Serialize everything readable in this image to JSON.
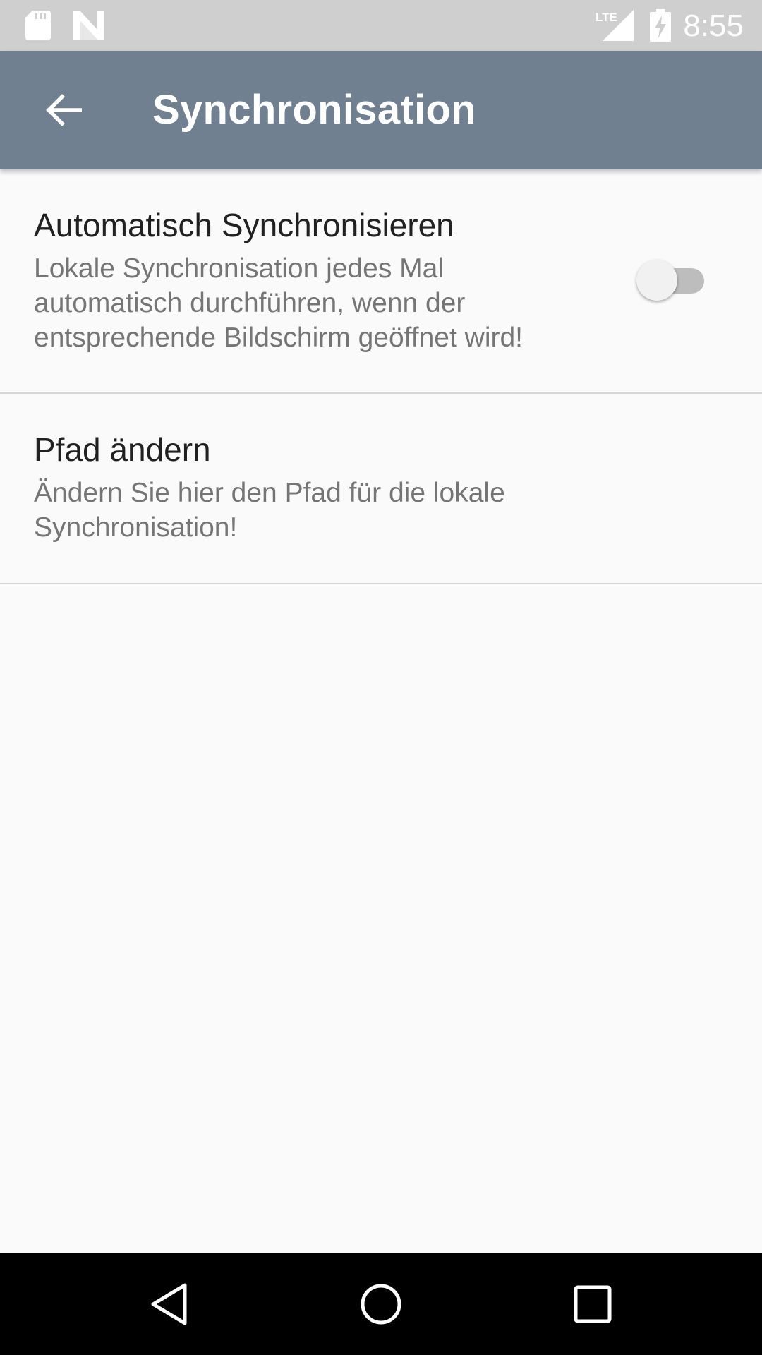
{
  "status_bar": {
    "time": "8:55",
    "network_type": "LTE",
    "icons": [
      "sd-card-icon",
      "n-logo-icon",
      "signal-icon",
      "battery-charging-icon"
    ]
  },
  "app_bar": {
    "title": "Synchronisation",
    "back_icon": "arrow-back-icon",
    "background_color": "#708090"
  },
  "preferences": [
    {
      "title": "Automatisch Synchronisieren",
      "summary": "Lokale Synchronisation jedes Mal automatisch durchführen, wenn der entsprechende Bildschirm geöffnet wird!",
      "switch_on": false
    },
    {
      "title": "Pfad ändern",
      "summary": "Ändern Sie hier den Pfad für die lokale Synchronisation!"
    }
  ],
  "nav_bar": {
    "icons": [
      "nav-back-icon",
      "nav-home-icon",
      "nav-recents-icon"
    ]
  }
}
